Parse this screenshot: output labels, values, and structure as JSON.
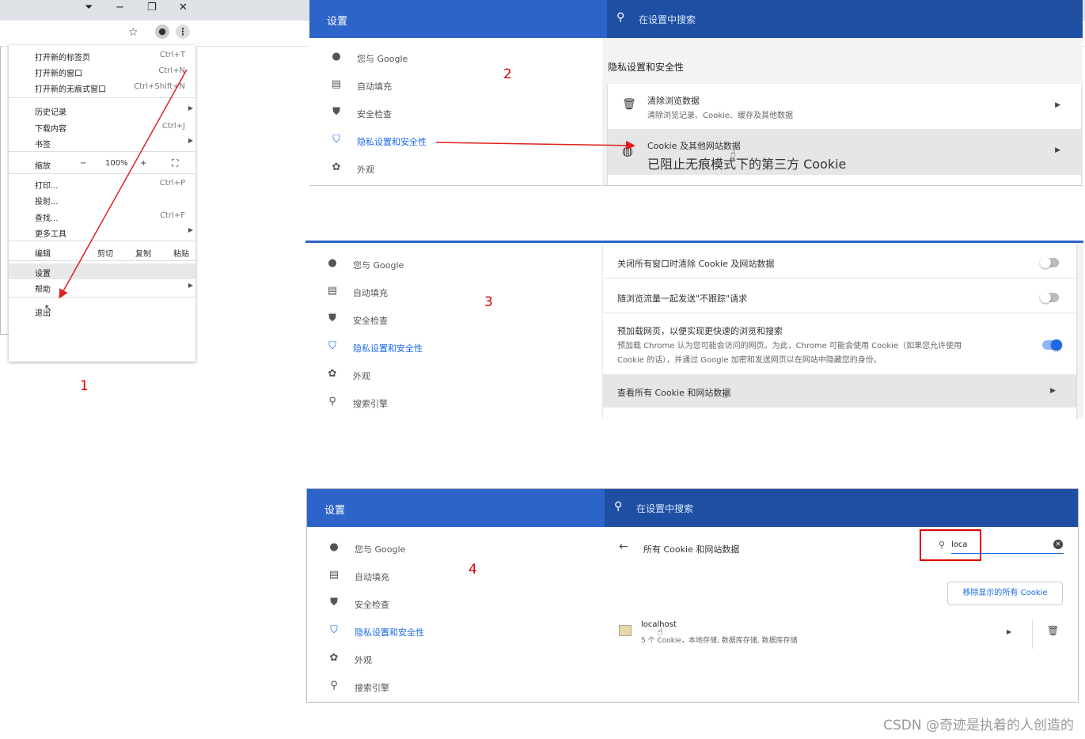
{
  "panel1": {
    "number": "1",
    "items": [
      {
        "label": "打开新的标签页",
        "shortcut": "Ctrl+T"
      },
      {
        "label": "打开新的窗口",
        "shortcut": "Ctrl+N"
      },
      {
        "label": "打开新的无痕式窗口",
        "shortcut": "Ctrl+Shift+N"
      },
      {
        "label": "历史记录",
        "shortcut": ""
      },
      {
        "label": "下载内容",
        "shortcut": "Ctrl+J"
      },
      {
        "label": "书签",
        "shortcut": ""
      },
      {
        "label": "缩放",
        "zoom_minus": "−",
        "zoom_value": "100%",
        "zoom_plus": "+"
      },
      {
        "label": "打印...",
        "shortcut": "Ctrl+P"
      },
      {
        "label": "投射...",
        "shortcut": ""
      },
      {
        "label": "查找...",
        "shortcut": "Ctrl+F"
      },
      {
        "label": "更多工具",
        "shortcut": ""
      },
      {
        "label": "编辑",
        "cut": "剪切",
        "copy": "复制",
        "paste": "粘贴"
      },
      {
        "label": "设置",
        "shortcut": ""
      },
      {
        "label": "帮助",
        "shortcut": ""
      },
      {
        "label": "退出",
        "shortcut": ""
      }
    ]
  },
  "settings": {
    "title": "设置",
    "search_placeholder": "在设置中搜索",
    "sidebar": [
      "您与 Google",
      "自动填充",
      "安全检查",
      "隐私设置和安全性",
      "外观",
      "搜索引擎"
    ]
  },
  "panel2": {
    "number": "2",
    "section_title": "隐私设置和安全性",
    "rows": [
      {
        "title": "清除浏览数据",
        "sub": "清除浏览记录、Cookie、缓存及其他数据"
      },
      {
        "title": "Cookie 及其他网站数据",
        "sub": "已阻止无痕模式下的第三方 Cookie"
      }
    ]
  },
  "panel3": {
    "number": "3",
    "rows": [
      {
        "title": "关闭所有窗口时清除 Cookie 及网站数据"
      },
      {
        "title": "随浏览流量一起发送\"不跟踪\"请求"
      },
      {
        "title": "预加载网页，以便实现更快速的浏览和搜索",
        "sub1": "预加载 Chrome 认为您可能会访问的网页。为此，Chrome 可能会使用 Cookie（如果您允许使用",
        "sub2": "Cookie 的话），并通过 Google 加密和发送网页以在网站中隐藏您的身份。"
      },
      {
        "title": "查看所有 Cookie 和网站数据"
      }
    ],
    "toggles": [
      false,
      false,
      true
    ]
  },
  "panel4": {
    "number": "4",
    "page_title": "所有 Cookie 和网站数据",
    "search_value": "loca",
    "remove_button": "移除显示的所有 Cookie",
    "site_name": "localhost",
    "site_detail": "5 个 Cookie，本地存储, 数据库存储, 数据库存储"
  },
  "colors": {
    "header": "#2d64c9",
    "search": "#1e4fa3",
    "accent": "#1a6ae6",
    "annotation": "#e02020"
  },
  "watermark": "CSDN @奇迹是执着的人创造的"
}
